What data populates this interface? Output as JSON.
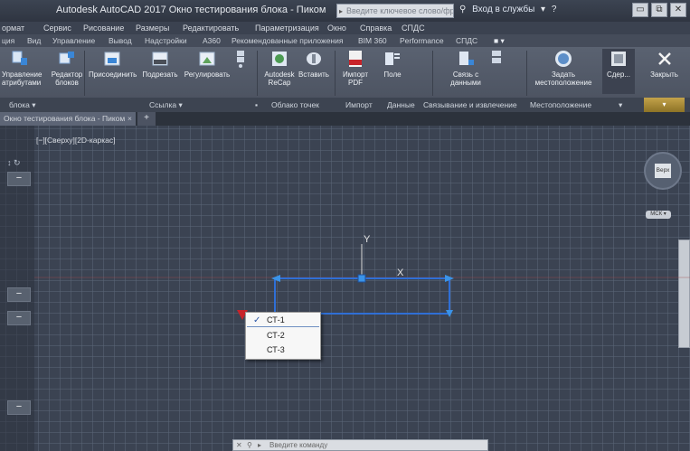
{
  "titlebar": {
    "app_title": "Autodesk AutoCAD 2017   Окно тестирования блока - Пиком",
    "search_placeholder": "Введите ключевое слово/фразу",
    "sign_in": "Вход в службы",
    "window_buttons": [
      "▭",
      "⧉",
      "✕"
    ]
  },
  "menubar": {
    "items": [
      "ормат",
      "Сервис",
      "Рисование",
      "Размеры",
      "Редактировать",
      "Параметризация",
      "Окно",
      "Справка",
      "СПДС"
    ]
  },
  "ribbon_tabs": {
    "items": [
      "ция",
      "Вид",
      "Управление",
      "Вывод",
      "Надстройки",
      "A360",
      "Рекомендованные приложения",
      "BIM 360",
      "Performance",
      "СПДС"
    ]
  },
  "ribbon": {
    "buttons": [
      {
        "label": "Управление атрибутами",
        "icon": "attribute-manager-icon"
      },
      {
        "label": "Редактор блоков",
        "icon": "block-editor-icon"
      },
      {
        "label": "Присоединить",
        "icon": "attach-icon"
      },
      {
        "label": "Подрезать",
        "icon": "clip-icon"
      },
      {
        "label": "Регулировать",
        "icon": "adjust-icon"
      },
      {
        "label": "Autodesk ReCap",
        "icon": "recap-icon"
      },
      {
        "label": "Вставить",
        "icon": "insert-icon"
      },
      {
        "label": "Импорт PDF",
        "icon": "pdf-import-icon"
      },
      {
        "label": "Поле",
        "icon": "field-icon"
      },
      {
        "label": "Связь с данными",
        "icon": "data-link-icon"
      },
      {
        "label": "Задать местоположение",
        "icon": "location-icon"
      },
      {
        "label": "Сдер...",
        "icon": "contain-icon"
      },
      {
        "label": "Закрыть",
        "icon": "close-icon"
      }
    ],
    "panels": [
      "блока ▾",
      "Ссылка ▾",
      "Облако точек",
      "Импорт",
      "Данные",
      "Связывание и извлечение",
      "Местоположение"
    ]
  },
  "file_tabs": {
    "active": "Окно тестирования блока - Пиком",
    "close_glyph": "×",
    "new_tab": "+"
  },
  "viewport": {
    "label": "[−][Сверху][2D-каркас]",
    "viewcube_face": "Верх",
    "wcs": "МСК ▾",
    "axis_y": "Y",
    "axis_x": "X"
  },
  "side_buttons": [
    "−",
    "−",
    "−",
    "−"
  ],
  "dropdown": {
    "items": [
      {
        "label": "СТ-1",
        "checked": true
      },
      {
        "label": "СТ-2",
        "checked": false
      },
      {
        "label": "СТ-3",
        "checked": false
      }
    ],
    "check_glyph": "✓"
  },
  "command_line": {
    "placeholder": "Введите команду",
    "icons": [
      "✕",
      "⚲",
      "▸"
    ]
  },
  "colors": {
    "canvas": "#3b4352",
    "block_outline": "#2f6fd6",
    "grip": "#3a93e8",
    "grip_red": "#c8232a",
    "axis": "#d8d8d8"
  }
}
